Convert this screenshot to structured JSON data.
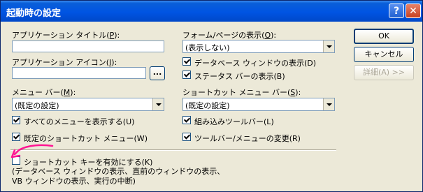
{
  "window": {
    "title": "起動時の設定",
    "help": "?",
    "close": "✕"
  },
  "app_title": {
    "label": "アプリケーション タイトル",
    "key": "P",
    "value": ""
  },
  "app_icon": {
    "label": "アプリケーション アイコン",
    "key": "I",
    "value": "",
    "browse": "..."
  },
  "menu_bar": {
    "label": "メニュー バー",
    "key": "M",
    "value": "(既定の設定)"
  },
  "form_page": {
    "label": "フォーム/ページの表示",
    "key": "O",
    "value": "(表示しない)"
  },
  "shortcut_menu_bar": {
    "label": "ショートカット メニュー バー",
    "key": "S",
    "value": "(既定の設定)"
  },
  "checks": {
    "show_db_window": {
      "label": "データベース ウィンドウの表示",
      "key": "D",
      "checked": true
    },
    "show_status_bar": {
      "label": "ステータス バーの表示",
      "key": "B",
      "checked": true
    },
    "all_menus": {
      "label": "すべてのメニューを表示する",
      "key": "U",
      "checked": true
    },
    "builtin_toolbars": {
      "label": "組み込みツールバー",
      "key": "L",
      "checked": true
    },
    "default_shortcut_menus": {
      "label": "既定のショートカット メニュー",
      "key": "W",
      "checked": true
    },
    "toolbar_changes": {
      "label": "ツールバー/メニューの変更",
      "key": "R",
      "checked": true
    },
    "special_keys": {
      "label": "ショートカット キーを有効にする",
      "key": "K",
      "checked": false
    }
  },
  "special_keys_desc": [
    "(データベース ウィンドウの表示、直前のウィンドウの表示、",
    "VB ウィンドウの表示、実行の中断)"
  ],
  "buttons": {
    "ok": "OK",
    "cancel": "キャンセル",
    "advanced": "詳細",
    "advanced_key": "A",
    "advanced_suffix": " >>"
  },
  "colors": {
    "title_bar": "#0054e3",
    "face": "#ece9d8",
    "annotation": "#ff1493"
  }
}
